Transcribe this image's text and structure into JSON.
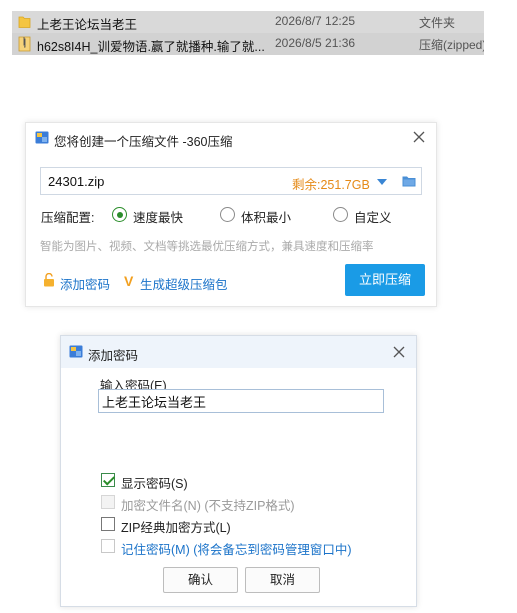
{
  "file_list": {
    "rows": [
      {
        "name": "上老王论坛当老王",
        "date": "2026/8/7 12:25",
        "type": "文件夹",
        "icon": "folder-icon"
      },
      {
        "name": "h62s8I4H_训爱物语.赢了就播种.输了就...",
        "date": "2026/8/5 21:36",
        "type": "压缩(zipped)",
        "icon": "zip-file-icon"
      }
    ]
  },
  "compress_dialog": {
    "title": "您将创建一个压缩文件 -360压缩",
    "filename": "24301.zip",
    "free_space": "剩余:251.7GB",
    "config_label": "压缩配置:",
    "options": [
      {
        "label": "速度最快",
        "selected": true
      },
      {
        "label": "体积最小",
        "selected": false
      },
      {
        "label": "自定义",
        "selected": false
      }
    ],
    "hint": "智能为图片、视频、文档等挑选最优压缩方式，兼具速度和压缩率",
    "add_password_link": "添加密码",
    "super_pack_link": "生成超级压缩包",
    "compress_button": "立即压缩",
    "accent_color": "#1a9be6"
  },
  "password_dialog": {
    "title": "添加密码",
    "input_label": "输入密码(E)",
    "password_value": "上老王论坛当老王",
    "checkboxes": [
      {
        "label": "显示密码(S)",
        "checked": true,
        "disabled": false
      },
      {
        "label": "加密文件名(N) (不支持ZIP格式)",
        "checked": false,
        "disabled": true
      },
      {
        "label": "ZIP经典加密方式(L)",
        "checked": false,
        "disabled": false
      },
      {
        "label": "记住密码(M) (将会备忘到密码管理窗口中)",
        "checked": false,
        "disabled": false
      }
    ],
    "ok_button": "确认",
    "cancel_button": "取消"
  }
}
